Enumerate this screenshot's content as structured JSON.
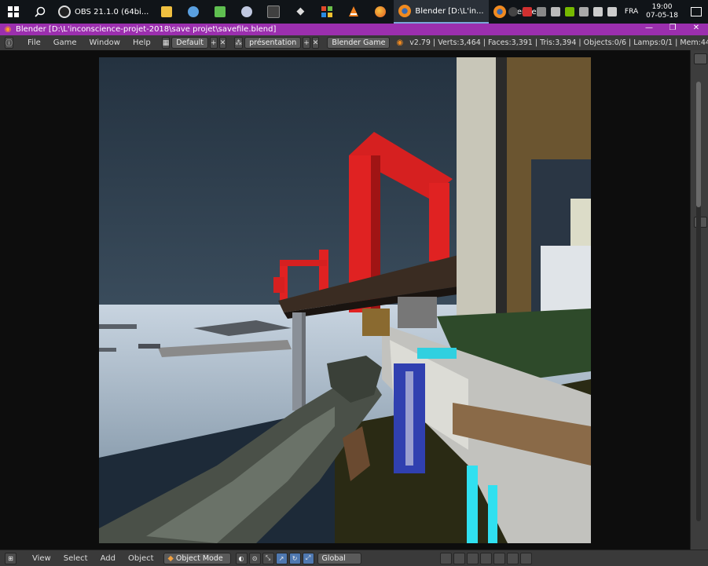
{
  "taskbar": {
    "apps": [
      {
        "name": "windows-start",
        "label": "",
        "color": "#ffffff",
        "icon": "windows-logo-icon"
      },
      {
        "name": "search",
        "label": "",
        "color": "#ffffff",
        "icon": "search-icon"
      },
      {
        "name": "obs",
        "label": "OBS 21.1.0 (64bi...",
        "color": "#e8e8e8",
        "icon": "obs-icon"
      },
      {
        "name": "file-explorer",
        "label": "",
        "color": "#f0c040",
        "icon": "folder-icon"
      },
      {
        "name": "paint",
        "label": "",
        "color": "#5aa0e0",
        "icon": "paint-icon"
      },
      {
        "name": "notepad",
        "label": "",
        "color": "#5fbf50",
        "icon": "notepad-icon"
      },
      {
        "name": "app-circle",
        "label": "",
        "color": "#c0c8e0",
        "icon": "circle-app-icon"
      },
      {
        "name": "terminal",
        "label": "",
        "color": "#404040",
        "icon": "terminal-icon"
      },
      {
        "name": "unity",
        "label": "",
        "color": "#dddddd",
        "icon": "unity-icon"
      },
      {
        "name": "office",
        "label": "",
        "color": "#e04a2a",
        "icon": "office-icon"
      },
      {
        "name": "vlc",
        "label": "",
        "color": "#f08020",
        "icon": "vlc-icon"
      },
      {
        "name": "firefox",
        "label": "",
        "color": "#e06a20",
        "icon": "firefox-icon"
      },
      {
        "name": "blender-active",
        "label": "Blender [D:\\L'in...",
        "color": "#f08a20",
        "icon": "blender-icon"
      },
      {
        "name": "blender",
        "label": "blender",
        "color": "#f08a20",
        "icon": "blender-icon"
      }
    ],
    "tray_lang": "FRA",
    "clock_time": "19:00",
    "clock_date": "07-05-18"
  },
  "titlebar": {
    "title": "Blender [D:\\L'inconscience-projet-2018\\save projet\\savefile.blend]",
    "color": "#9b2fae"
  },
  "info_header": {
    "menus": [
      "File",
      "Game",
      "Window",
      "Help"
    ],
    "screen_layout": "Default",
    "scene": "présentation",
    "engine": "Blender Game",
    "stats": "v2.79 | Verts:3,464 | Faces:3,391 | Tris:3,394 | Objects:0/6 | Lamps:0/1 | Mem:44"
  },
  "bottom_header": {
    "menus": [
      "View",
      "Select",
      "Add",
      "Object"
    ],
    "mode": "Object Mode",
    "orientation": "Global"
  }
}
